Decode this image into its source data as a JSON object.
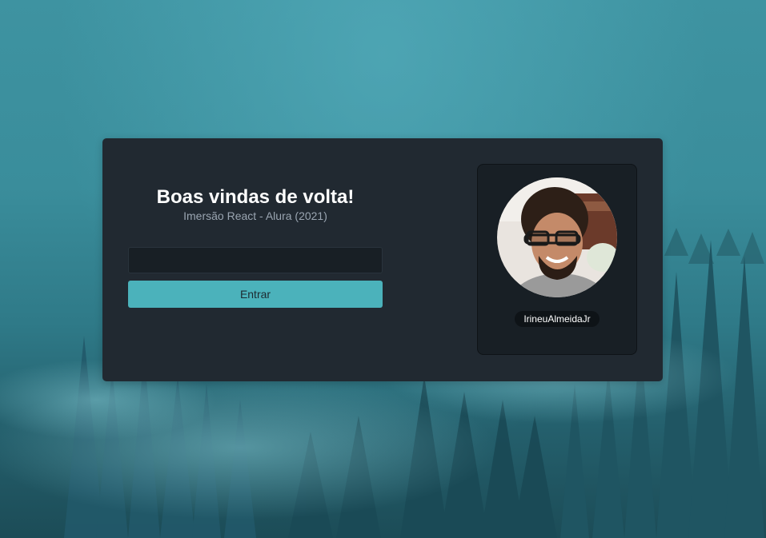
{
  "page": {
    "title": "Boas vindas de volta!",
    "subtitle": "Imersão React - Alura (2021)"
  },
  "form": {
    "username_value": "",
    "submit_label": "Entrar"
  },
  "profile": {
    "avatar_icon": "user-photo",
    "username": "IrineuAlmeidaJr"
  },
  "colors": {
    "card_background": "#212931",
    "input_background": "#181f25",
    "button_accent": "#4bb2bb",
    "title": "#ffffff",
    "subtitle": "#9aa5b1"
  }
}
